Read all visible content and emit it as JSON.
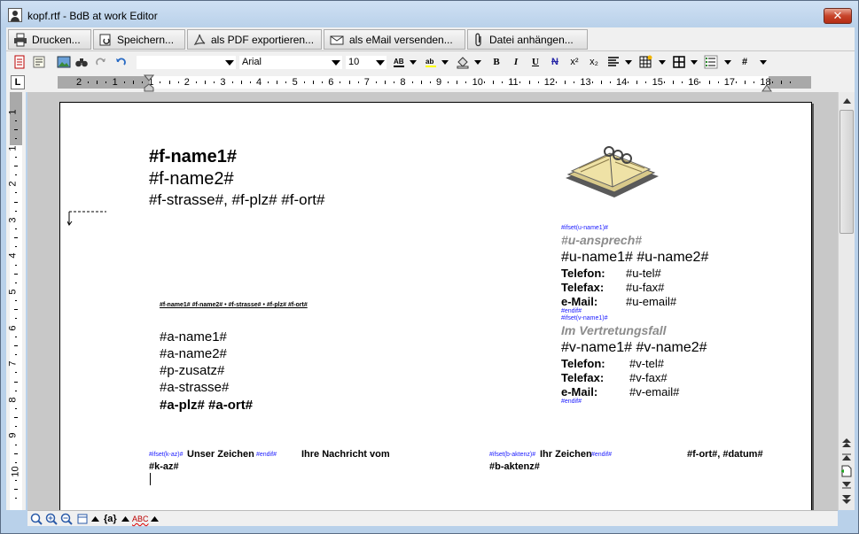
{
  "window": {
    "title": "kopf.rtf - BdB at work Editor",
    "close_glyph": "✕"
  },
  "actions": [
    {
      "label": "Drucken..."
    },
    {
      "label": "Speichern..."
    },
    {
      "label": "als PDF exportieren..."
    },
    {
      "label": "als eMail versenden..."
    },
    {
      "label": "Datei anhängen..."
    }
  ],
  "format": {
    "style_value": "",
    "font_value": "Arial",
    "size_value": "10",
    "bold": "B",
    "italic": "I",
    "underline": "U",
    "strike": "N",
    "superscript": "x²",
    "subscript": "x₂",
    "hash": "#"
  },
  "ruler": {
    "tab_selector": "L",
    "numbers": [
      "2",
      "1",
      "1",
      "2",
      "3",
      "4",
      "5",
      "6",
      "7",
      "8",
      "9",
      "10",
      "11",
      "12",
      "13",
      "14",
      "15",
      "16",
      "17",
      "18"
    ],
    "vnumbers": [
      "1",
      "1",
      "2",
      "3",
      "4",
      "5",
      "6",
      "7",
      "8",
      "9",
      "10"
    ]
  },
  "document": {
    "f_name1": "#f-name1#",
    "f_name2": "#f-name2#",
    "f_address": "#f-strasse#, #f-plz# #f-ort#",
    "sender_line": "#f-name1# #f-name2# • #f-strasse# • #f-plz# #f-ort#",
    "a_name1": "#a-name1#",
    "a_name2": "#a-name2#",
    "p_zusatz": "#p-zusatz#",
    "a_strasse": "#a-strasse#",
    "a_plz_ort": "#a-plz# #a-ort#",
    "ifset_u": "#ifset(u-name1)#",
    "u_ansprech": "#u-ansprech#",
    "u_names": "#u-name1# #u-name2#",
    "u_contacts": [
      {
        "label": "Telefon:",
        "value": "#u-tel#"
      },
      {
        "label": "Telefax:",
        "value": "#u-fax#"
      },
      {
        "label": "e-Mail:",
        "value": "#u-email#"
      }
    ],
    "endif_1": "#endif#",
    "ifset_v": "#ifset(v-name1)#",
    "v_heading": "Im Vertretungsfall",
    "v_names": "#v-name1# #v-name2#",
    "v_contacts": [
      {
        "label": "Telefon:",
        "value": "#v-tel#"
      },
      {
        "label": "Telefax:",
        "value": "#v-fax#"
      },
      {
        "label": "e-Mail:",
        "value": "#v-email#"
      }
    ],
    "endif_2": "#endif#",
    "ifset_kaz": "#ifset(k-az)#",
    "unser_zeichen": "Unser Zeichen",
    "endif_3": "#endif#",
    "ihre_nachricht": "Ihre Nachricht vom",
    "ifset_baktenz": "#ifset(b-aktenz)#",
    "ihr_zeichen": "Ihr Zeichen",
    "endif_4": "#endif#",
    "ort_datum": "#f-ort#, #datum#",
    "k_az": "#k-az#",
    "b_aktenz": "#b-aktenz#"
  },
  "status": {
    "field_label": "{a}",
    "spell_label": "ABC"
  }
}
